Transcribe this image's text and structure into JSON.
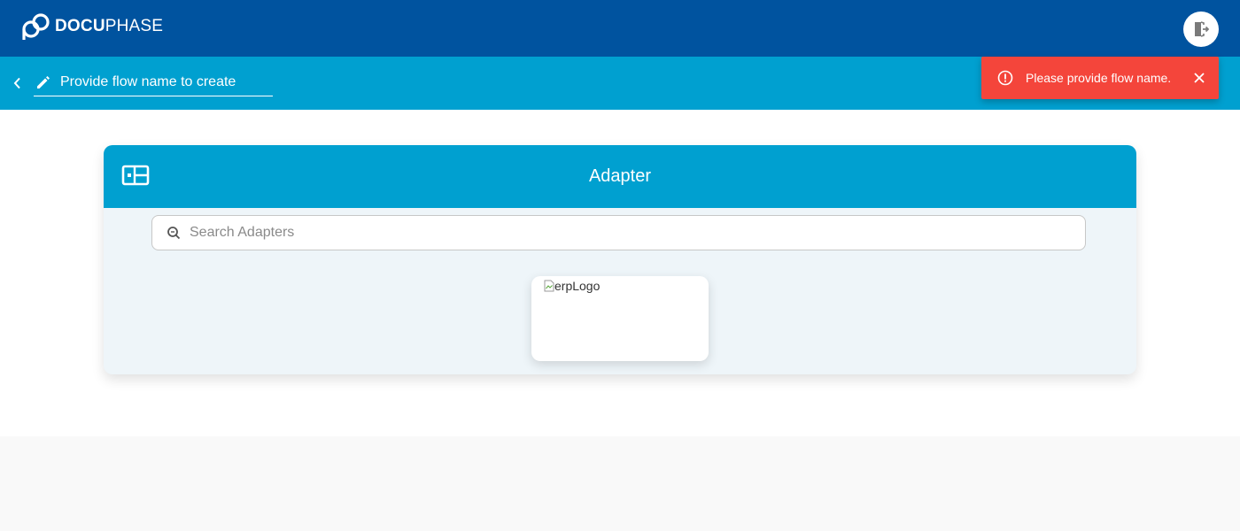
{
  "header": {
    "brand_bold": "DOCU",
    "brand_light": "PHASE",
    "logout_icon": "logout-icon"
  },
  "toolbar": {
    "back_icon": "chevron-left-icon",
    "edit_icon": "pencil-icon",
    "flow_name_placeholder": "Provide flow name to create",
    "flow_name_value": ""
  },
  "toast": {
    "icon": "error-circle-icon",
    "message": "Please provide flow name.",
    "close_icon": "close-icon",
    "color": "#f4453b"
  },
  "adapter_panel": {
    "title": "Adapter",
    "icon": "dashboard-layout-icon",
    "search_placeholder": "Search Adapters",
    "search_value": "",
    "items": [
      {
        "alt_text": "erpLogo"
      }
    ]
  },
  "colors": {
    "primary_dark": "#00539f",
    "primary_light": "#00a0d0",
    "panel_bg": "#eef5f9"
  }
}
